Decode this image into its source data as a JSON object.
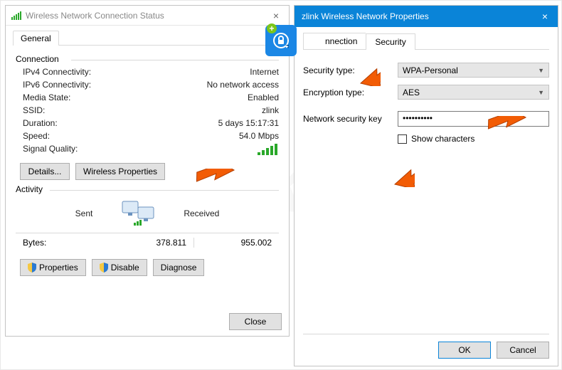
{
  "status_window": {
    "title": "Wireless Network Connection Status",
    "tab_general": "General",
    "connection_legend": "Connection",
    "ipv4_label": "IPv4 Connectivity:",
    "ipv4_value": "Internet",
    "ipv6_label": "IPv6 Connectivity:",
    "ipv6_value": "No network access",
    "media_label": "Media State:",
    "media_value": "Enabled",
    "ssid_label": "SSID:",
    "ssid_value": "zlink",
    "duration_label": "Duration:",
    "duration_value": "5 days 15:17:31",
    "speed_label": "Speed:",
    "speed_value": "54.0 Mbps",
    "signal_label": "Signal Quality:",
    "details_btn": "Details...",
    "wireless_props_btn": "Wireless Properties",
    "activity_legend": "Activity",
    "sent_label": "Sent",
    "received_label": "Received",
    "bytes_label": "Bytes:",
    "bytes_sent": "378.811",
    "bytes_received": "955.002",
    "properties_btn": "Properties",
    "disable_btn": "Disable",
    "diagnose_btn": "Diagnose",
    "close_btn": "Close"
  },
  "props_window": {
    "title": "zlink Wireless Network Properties",
    "tab_connection": "Connection",
    "tab_connection_visible": "nnection",
    "tab_security": "Security",
    "security_type_label": "Security type:",
    "security_type_value": "WPA-Personal",
    "encryption_type_label": "Encryption type:",
    "encryption_type_value": "AES",
    "network_key_label": "Network security key",
    "network_key_value": "••••••••••",
    "show_characters_label": "Show characters",
    "ok_btn": "OK",
    "cancel_btn": "Cancel"
  },
  "watermark": "pcrisk.com"
}
